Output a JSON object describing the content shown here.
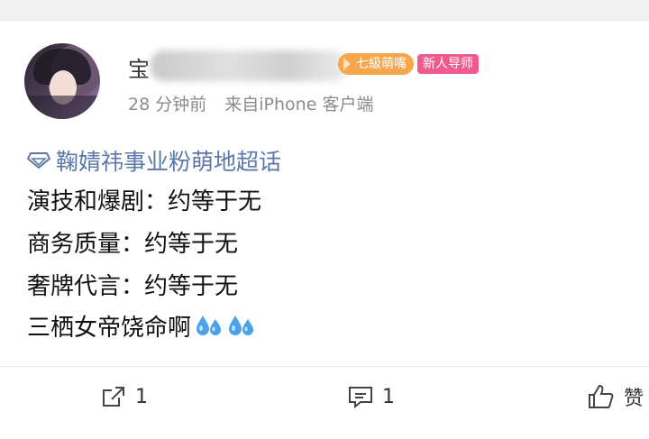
{
  "post": {
    "author_prefix": "宝",
    "level_badge": "七級萌嘴",
    "mentor_badge": "新人导师",
    "time": "28 分钟前",
    "source": "来自iPhone 客户端",
    "topic": "鞠婧祎事业粉萌地超话",
    "lines": [
      "演技和爆剧：约等于无",
      "商务质量：约等于无",
      "奢牌代言：约等于无",
      "三栖女帝饶命啊"
    ],
    "emoji": [
      "sweat-drops-icon",
      "sweat-drops-icon"
    ]
  },
  "actions": {
    "share_count": "1",
    "comment_count": "1",
    "like_label": "赞"
  },
  "colors": {
    "topic": "#5b78a9",
    "level_badge": "#f7a64b",
    "mentor_badge": "#f05a8d",
    "meta": "#8c8c8c",
    "drops": "#4aa3e8"
  }
}
